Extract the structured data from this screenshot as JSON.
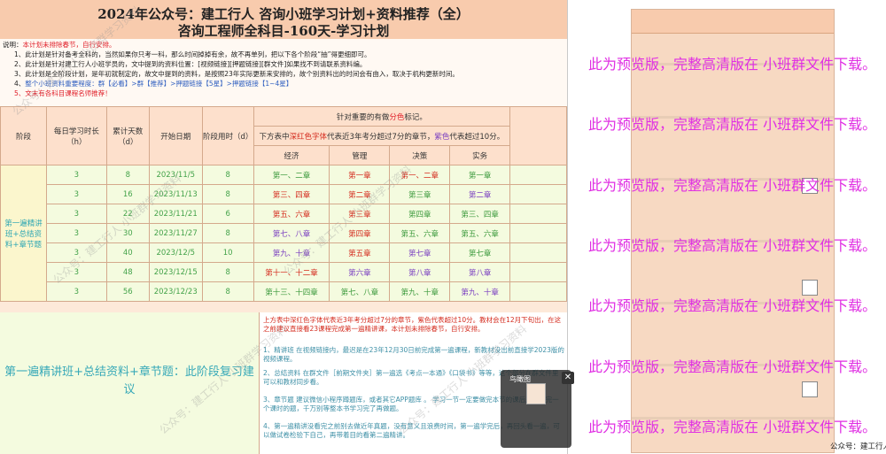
{
  "document": {
    "title_line1": "2024年公众号：建工行人 咨询小班学习计划+资料推荐（全）",
    "title_line2": "咨询工程师全科目-160天-学习计划",
    "notes": [
      {
        "prefix": "说明：",
        "text": "本计划未排除春节，自行安排。"
      },
      {
        "prefix": "1、",
        "text": "此计划是针对备考全科的，当然如果你只考一科，那么时间掉掉有余，故不再单列，把以下各个阶段“抽”得更细即可。"
      },
      {
        "prefix": "2、",
        "text": "此计划是针对建工行人小班学员的，文中提到的资料位置：[视频链接][押题链接][群文件]如果找不到请联系资料编。"
      },
      {
        "prefix": "3、",
        "text": "此计划是全阶段计划，是年初就制定的，故文中提到的资料，是按照23年实际更新来安排的，故个别资料出的时间会有由入，取决于机构更新时间。"
      },
      {
        "prefix": "4、",
        "text": "整个小班资料重要程度：群【必看】>群【推荐】>押题链接【5星】>押题链接【1~4星】"
      },
      {
        "prefix": "5、",
        "text": "文末有各科目课程名师推荐！"
      }
    ],
    "table": {
      "headers": {
        "stage": "阶段",
        "daily_hours": "每日学习时长（h）",
        "cumulative_days": "累计天数（d）",
        "start_date": "开始日期",
        "stage_hours": "阶段用时（d）",
        "marking_note_prefix": "针对重要的有做",
        "marking_note_highlight": "分色",
        "marking_note_suffix": "标记。",
        "legend_prefix": "下方表中",
        "legend_red": "深红色字体",
        "legend_mid": "代表近3年考分超过7分的章节，",
        "legend_purple": "紫色",
        "legend_suffix": "代表超过10分。",
        "subjects": [
          "经济",
          "管理",
          "决策",
          "实务"
        ]
      },
      "stage_label": "第一遍精讲班+总结资料+章节题",
      "rows": [
        {
          "daily": "3",
          "cum": "8",
          "date": "2023/11/5",
          "hours": "8",
          "jingji": "第一、二章",
          "guanli": "第一章",
          "juece": "第一、二章",
          "shiwu": "第一章"
        },
        {
          "daily": "3",
          "cum": "16",
          "date": "2023/11/13",
          "hours": "8",
          "jingji": "第三、四章",
          "guanli": "第二章",
          "juece": "第三章",
          "shiwu": "第二章"
        },
        {
          "daily": "3",
          "cum": "22",
          "date": "2023/11/21",
          "hours": "6",
          "jingji": "第五、六章",
          "guanli": "第三章",
          "juece": "第四章",
          "shiwu": "第三、四章"
        },
        {
          "daily": "3",
          "cum": "30",
          "date": "2023/11/27",
          "hours": "8",
          "jingji": "第七、八章",
          "guanli": "第四章",
          "juece": "第五、六章",
          "shiwu": "第五、六章"
        },
        {
          "daily": "3",
          "cum": "40",
          "date": "2023/12/5",
          "hours": "10",
          "jingji": "第九、十章",
          "guanli": "第五章",
          "juece": "第七章",
          "shiwu": "第七章"
        },
        {
          "daily": "3",
          "cum": "48",
          "date": "2023/12/15",
          "hours": "8",
          "jingji": "第十一、十二章",
          "guanli": "第六章",
          "juece": "第八章",
          "shiwu": "第八章"
        },
        {
          "daily": "3",
          "cum": "56",
          "date": "2023/12/23",
          "hours": "8",
          "jingji": "第十三、十四章",
          "guanli": "第七、八章",
          "juece": "第九、十章",
          "shiwu": "第九、十章"
        }
      ]
    },
    "review": {
      "title": "第一遍精讲班+总结资料+章节题：此阶段复习建议",
      "lines": [
        "上方表中深红色字体代表近3年考分超过7分的章节，紫色代表超过10分。教材会在12月下旬出，在这之前建议直接看23课程完成第一遍精讲课，本计划未排除春节，自行安排。",
        "1、精讲班 在视频链接内，最迟是在23年12月30日前完成第一遍课程，新教材没出前直接学2023版的视频课程。",
        "2、总结资料 在群文件［前期文件夹］第一遍选《考点一本通》《口袋书》等等，这个部分在群文件里可以和教材同步看。",
        "3、章节题 建议微信小程序蹲题库，或者其它APP题库 。 学习一节一定要做完本节的课后题，学完一个课时的题，千万别等整本书学习完了再做题。",
        "4、第一遍精讲没看完之前别去做近年真题，没有意义且浪费时间，第一遍学完后，再回头看一遍，可以做试卷检验下自己，再带着目的看第二遍精讲。"
      ]
    },
    "watermark": "公众号：建工行人 小班群学习资料"
  },
  "widget": {
    "label": "鸟瞰图",
    "close": "✕"
  },
  "preview": {
    "notice": "此为预览版，完整高清版在 小班群文件下载。",
    "notice_count": 7,
    "footer": "公众号：建工行人"
  },
  "colors": {
    "title_bg": "#f8cbad",
    "doc_bg": "#fde9d9",
    "deep_red": "#d42b1e",
    "purple": "#7a3fc0",
    "green": "#3c9a3c",
    "teal": "#2aa3b0",
    "notice_magenta": "#e02fe3"
  }
}
